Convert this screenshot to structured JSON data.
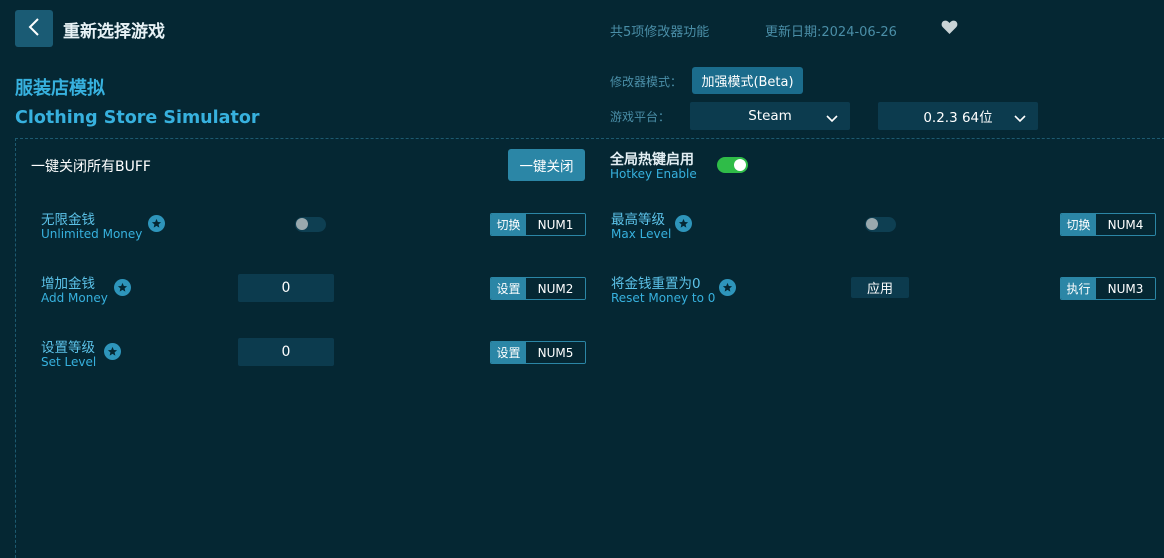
{
  "header": {
    "title": "重新选择游戏",
    "feature_count": "共5项修改器功能",
    "update_date": "更新日期:2024-06-26"
  },
  "game": {
    "name_cn": "服装店模拟",
    "name_en": "Clothing Store Simulator"
  },
  "settings": {
    "mode_label": "修改器模式：",
    "mode_value": "加强模式(Beta)",
    "platform_label": "游戏平台：",
    "platform_value": "Steam",
    "version_value": "0.2.3 64位"
  },
  "global": {
    "disable_all_label": "一键关闭所有BUFF",
    "disable_all_button": "一键关闭",
    "hotkey_cn": "全局热键启用",
    "hotkey_en": "Hotkey Enable",
    "hotkey_enabled": true
  },
  "options": [
    {
      "name_cn": "无限金钱",
      "name_en": "Unlimited Money",
      "control": "toggle",
      "enabled": false,
      "action": "切换",
      "key": "NUM1"
    },
    {
      "name_cn": "最高等级",
      "name_en": "Max Level",
      "control": "toggle",
      "enabled": false,
      "action": "切换",
      "key": "NUM4"
    },
    {
      "name_cn": "增加金钱",
      "name_en": "Add Money",
      "control": "input",
      "value": "0",
      "action": "设置",
      "key": "NUM2"
    },
    {
      "name_cn": "将金钱重置为0",
      "name_en": "Reset Money to 0",
      "control": "button",
      "button_label": "应用",
      "action": "执行",
      "key": "NUM3"
    },
    {
      "name_cn": "设置等级",
      "name_en": "Set Level",
      "control": "input",
      "value": "0",
      "action": "设置",
      "key": "NUM5"
    }
  ],
  "colors": {
    "background": "#052733",
    "accent": "#37b1de",
    "button": "#2b86a6",
    "toggle_on": "#2fbc48"
  },
  "icons": [
    "back-arrow-icon",
    "heart-icon",
    "chevron-down-icon",
    "star-icon"
  ]
}
